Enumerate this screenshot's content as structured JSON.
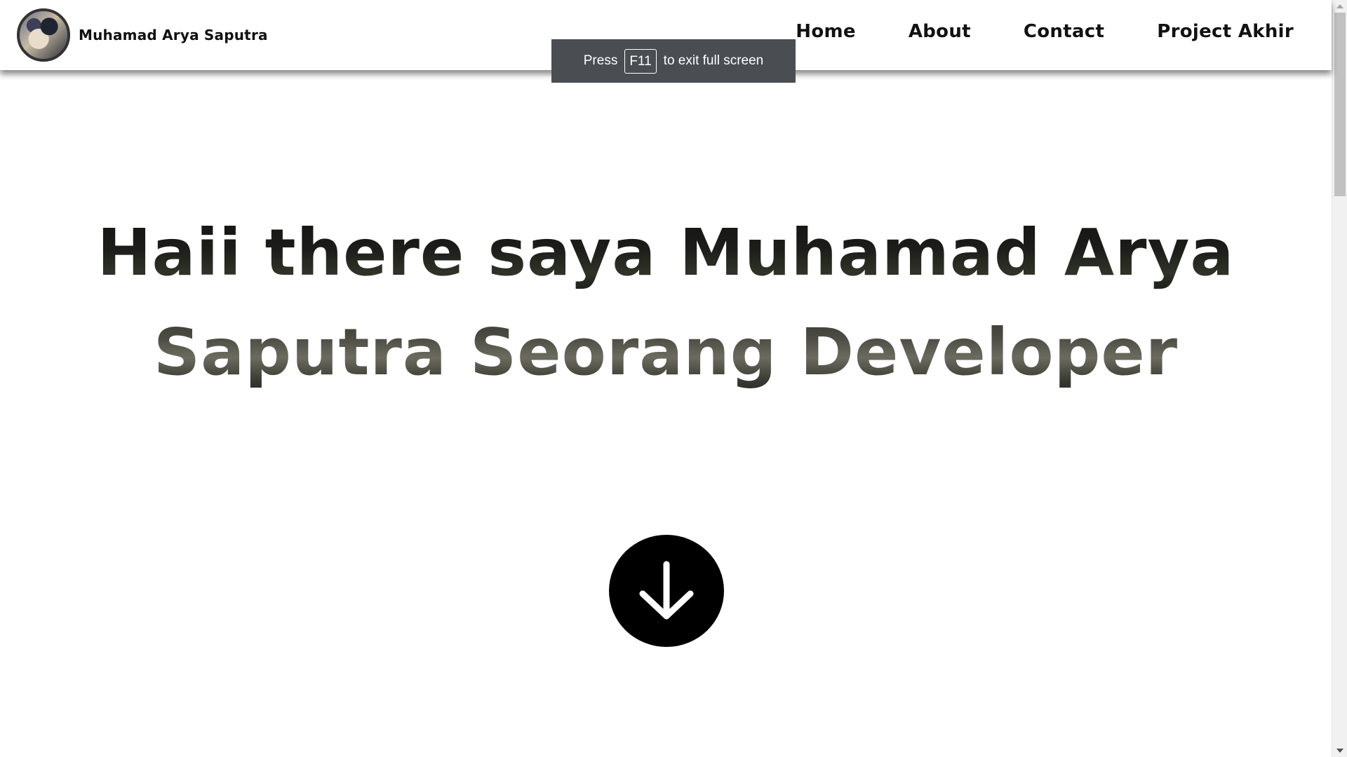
{
  "navbar": {
    "brand_name": "Muhamad Arya Saputra",
    "links": [
      {
        "label": "Home"
      },
      {
        "label": "About"
      },
      {
        "label": "Contact"
      },
      {
        "label": "Project Akhir"
      }
    ]
  },
  "fullscreen_toast": {
    "prefix": "Press",
    "key": "F11",
    "suffix": "to exit full screen"
  },
  "hero": {
    "line1": "Haii there saya Muhamad Arya",
    "line2": "Saputra Seorang Developer"
  },
  "scroll_button": {
    "icon": "arrow-down-icon"
  },
  "colors": {
    "navbar_bg": "#ffffff",
    "toast_bg": "#4a4e53",
    "text": "#111111",
    "button_bg": "#000000"
  }
}
